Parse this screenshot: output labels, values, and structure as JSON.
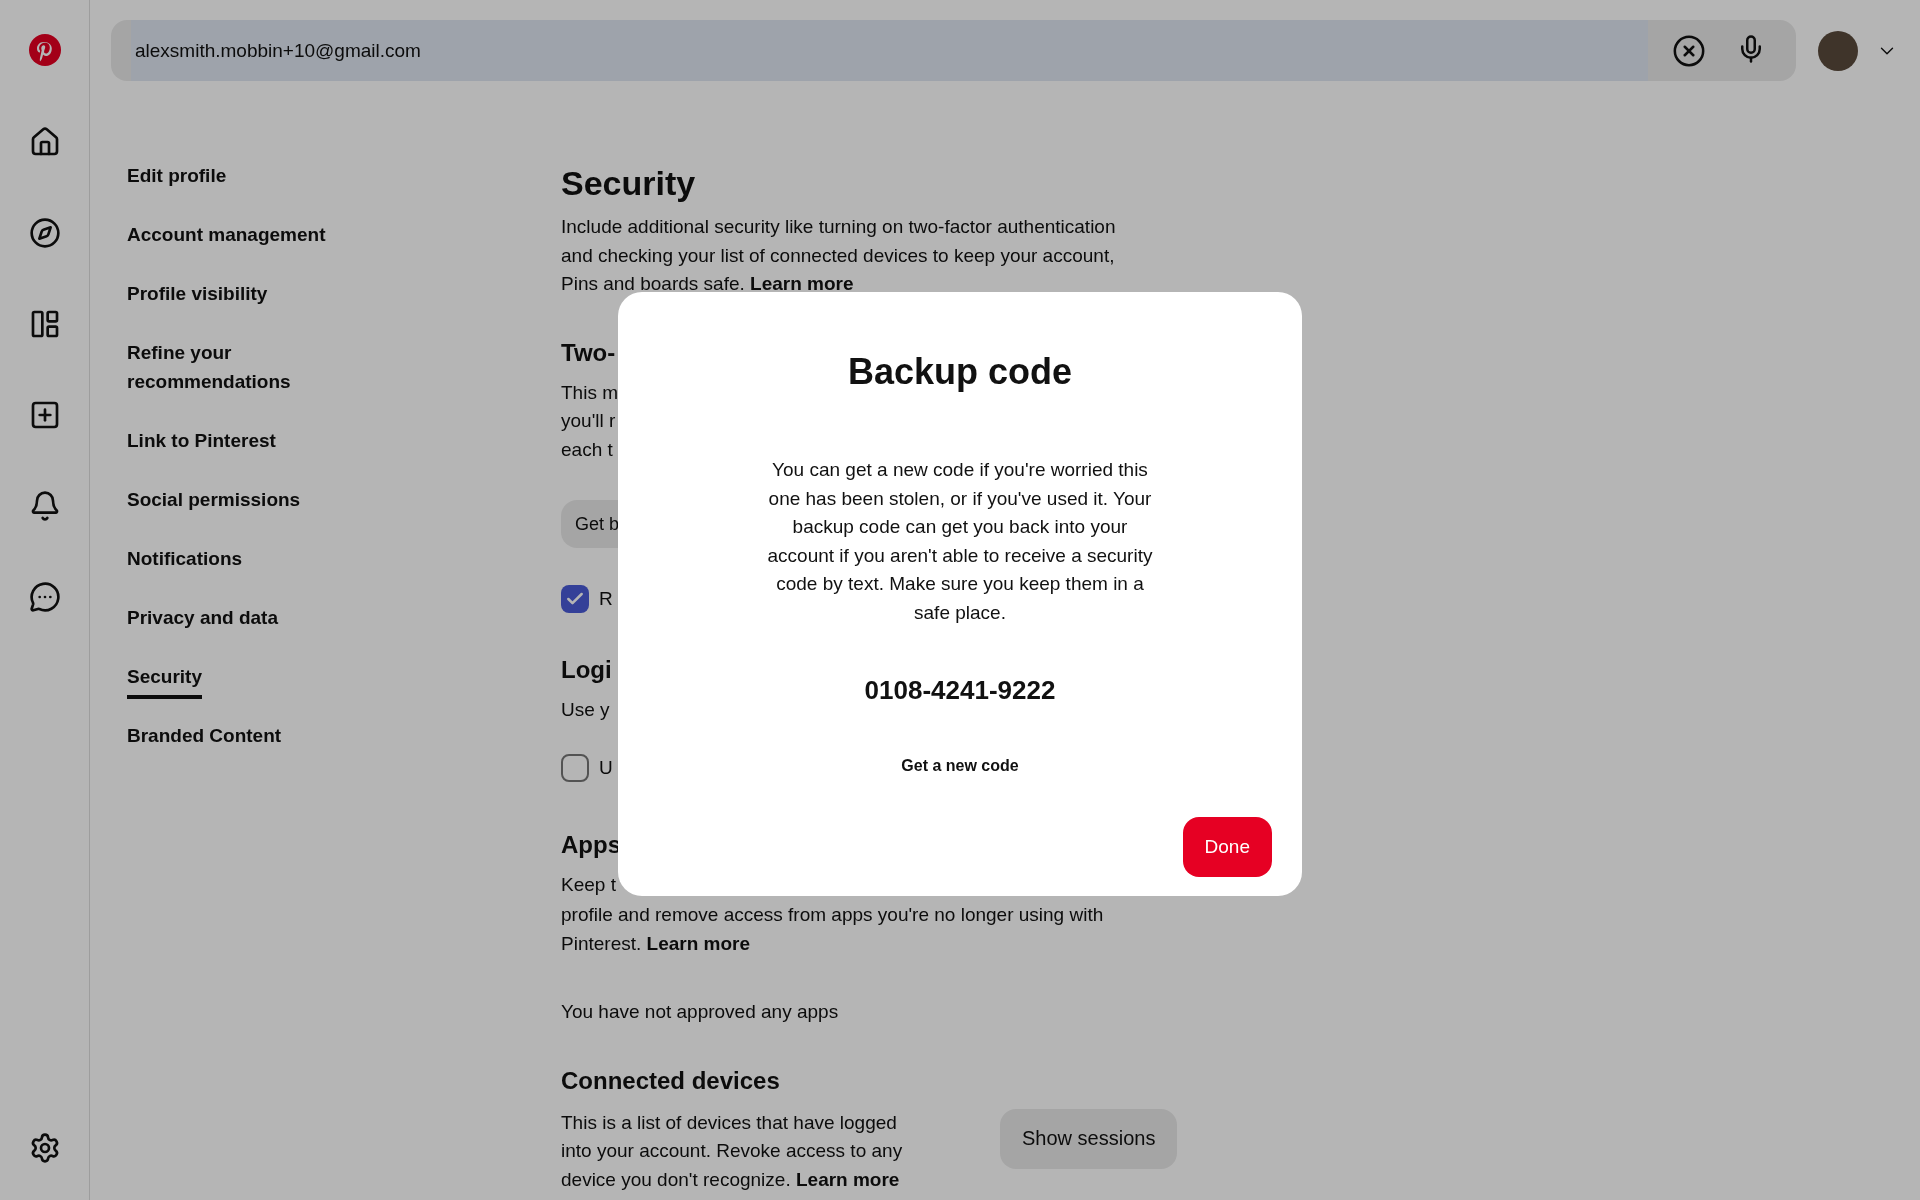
{
  "search": {
    "value": "alexsmith.mobbin+10@gmail.com"
  },
  "nav": [
    {
      "label": "Edit profile",
      "selected": false
    },
    {
      "label": "Account management",
      "selected": false
    },
    {
      "label": "Profile visibility",
      "selected": false
    },
    {
      "label": "Refine your recommendations",
      "selected": false
    },
    {
      "label": "Link to Pinterest",
      "selected": false
    },
    {
      "label": "Social permissions",
      "selected": false
    },
    {
      "label": "Notifications",
      "selected": false
    },
    {
      "label": "Privacy and data",
      "selected": false
    },
    {
      "label": "Security",
      "selected": true
    },
    {
      "label": "Branded Content",
      "selected": false
    }
  ],
  "page": {
    "title": "Security",
    "intro": "Include additional security like turning on two-factor authentication and checking your list of connected devices to keep your account, Pins and boards safe.",
    "link": "Learn more"
  },
  "two_factor": {
    "title": "Two-",
    "lines": [
      "This m",
      "you'll r",
      "each t"
    ],
    "button": "Get b",
    "checkbox": {
      "label": "R",
      "checked": true
    }
  },
  "login": {
    "title": "Logi",
    "lines": [
      "Use y"
    ],
    "checkbox": {
      "label": "U",
      "checked": false
    }
  },
  "apps": {
    "title": "Apps",
    "lines": [
      "Keep t",
      "profile and remove access from apps you're no longer using with"
    ],
    "last_line": "Pinterest.",
    "link": "Learn more",
    "empty": "You have not approved any apps"
  },
  "connected": {
    "title": "Connected devices",
    "text": "This is a list of devices that have logged into your account. Revoke access to any device you don't recognize.",
    "link": "Learn more",
    "button": "Show sessions"
  },
  "modal": {
    "title": "Backup code",
    "body": "You can get a new code if you're worried this one has been stolen, or if you've used it. Your backup code can get you back into your account if you aren't able to receive a security code by text. Make sure you keep them in a safe place.",
    "code": "0108-4241-9222",
    "link": "Get a new code",
    "button": "Done"
  }
}
